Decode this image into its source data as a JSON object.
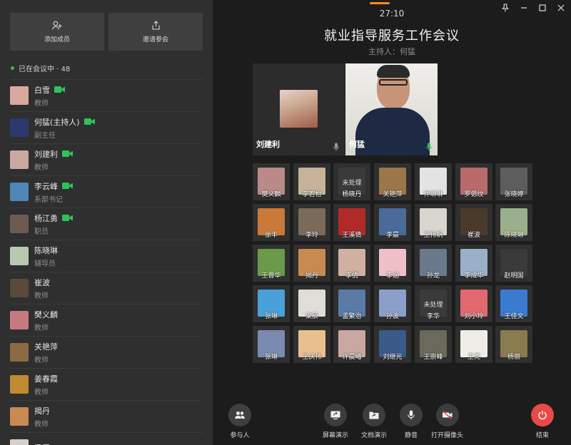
{
  "sidebar": {
    "add_member": "添加成员",
    "invite": "邀请参会",
    "status": "已在会议中 · 48",
    "members": [
      {
        "name": "白雪",
        "role": "教师",
        "cam": true,
        "color": "#d9a9a0"
      },
      {
        "name": "何猛(主持人)",
        "role": "副主任",
        "cam": true,
        "color": "#2b3a6a"
      },
      {
        "name": "刘建利",
        "role": "教师",
        "cam": true,
        "color": "#c9a8a0"
      },
      {
        "name": "李云峰",
        "role": "系部书记",
        "cam": true,
        "color": "#4f86b8"
      },
      {
        "name": "杨江勇",
        "role": "职员",
        "cam": true,
        "color": "#6d5b52"
      },
      {
        "name": "陈晓琳",
        "role": "辅导员",
        "cam": false,
        "color": "#b9c8b0"
      },
      {
        "name": "崔波",
        "role": "教师",
        "cam": false,
        "color": "#5a4a3a"
      },
      {
        "name": "樊义麟",
        "role": "教师",
        "cam": false,
        "color": "#c57a80"
      },
      {
        "name": "关艳萍",
        "role": "教师",
        "cam": false,
        "color": "#8a6a40"
      },
      {
        "name": "姜春霞",
        "role": "教师",
        "cam": false,
        "color": "#c08a30"
      },
      {
        "name": "揭丹",
        "role": "教师",
        "cam": false,
        "color": "#c88a50"
      },
      {
        "name": "梁辰",
        "role": "",
        "cam": false,
        "color": "#d8d0c8"
      }
    ]
  },
  "meeting": {
    "timer": "27:10",
    "title": "就业指导服务工作会议",
    "host": "主持人：何猛",
    "speakers": [
      {
        "name": "刘建利"
      },
      {
        "name": "何猛"
      }
    ]
  },
  "grid": [
    {
      "name": "樊义麟",
      "color": "#b98a88"
    },
    {
      "name": "李若怡",
      "color": "#c7b39a"
    },
    {
      "name": "杨晓丹",
      "unhandled": "未处理",
      "color": "#3a3a3a"
    },
    {
      "name": "关艳萍",
      "color": "#9a7648"
    },
    {
      "name": "仲琳琳",
      "color": "#e3e3e3"
    },
    {
      "name": "罗偲纹",
      "color": "#b96a6a"
    },
    {
      "name": "张晓婷",
      "color": "#5d5d5d"
    },
    {
      "name": "徐丰",
      "color": "#c97a3a"
    },
    {
      "name": "李玲",
      "color": "#7a6a5a"
    },
    {
      "name": "王溪倩",
      "color": "#b02a2a"
    },
    {
      "name": "李晨",
      "color": "#4a6a9a"
    },
    {
      "name": "王伟帆",
      "color": "#d9d6cf"
    },
    {
      "name": "崔波",
      "color": "#4a3a2a"
    },
    {
      "name": "陈晓琳",
      "color": "#9ab08a"
    },
    {
      "name": "王晋华",
      "color": "#6a9a4a"
    },
    {
      "name": "揭丹",
      "color": "#c88a50"
    },
    {
      "name": "李倩",
      "color": "#d0b0a0"
    },
    {
      "name": "李涵",
      "color": "#f0c0c8"
    },
    {
      "name": "孙龙",
      "color": "#6a7a8a"
    },
    {
      "name": "李成华",
      "color": "#9ab0c8"
    },
    {
      "name": "赵明国",
      "color": "#3a3a3a"
    },
    {
      "name": "张琳",
      "color": "#4aa0d8"
    },
    {
      "name": "梁辰",
      "color": "#e0dcd8"
    },
    {
      "name": "孟繁治",
      "color": "#5a7aa8"
    },
    {
      "name": "孙波",
      "color": "#8aa0c8"
    },
    {
      "name": "李华",
      "unhandled": "未处理",
      "color": "#3a3a3a"
    },
    {
      "name": "刘小玲",
      "color": "#e06a70"
    },
    {
      "name": "王佳文",
      "color": "#3a7ad0"
    },
    {
      "name": "张琳",
      "color": "#7a8ab0"
    },
    {
      "name": "王庆伟",
      "color": "#e8c090"
    },
    {
      "name": "许晨曦",
      "color": "#c8a8a0"
    },
    {
      "name": "刘继光",
      "color": "#3a5a8a"
    },
    {
      "name": "王崇峰",
      "color": "#6a6a5a"
    },
    {
      "name": "王亮",
      "color": "#f0ece8"
    },
    {
      "name": "杨丽",
      "color": "#8a7a50"
    }
  ],
  "toolbar": {
    "participants": "参与人",
    "screen_share": "屏幕演示",
    "doc_share": "文档演示",
    "mute": "静音",
    "camera": "打开摄像头",
    "end": "结束",
    "end_color": "#e84a45"
  }
}
